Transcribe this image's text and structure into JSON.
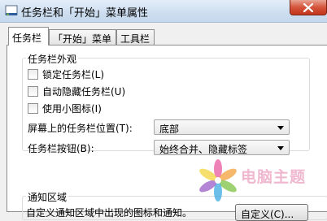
{
  "window": {
    "title": "任务栏和「开始」菜单属性",
    "close_icon": "close-icon"
  },
  "tabs": [
    {
      "label": "任务栏",
      "active": true
    },
    {
      "label": "「开始」菜单",
      "active": false
    },
    {
      "label": "工具栏",
      "active": false
    }
  ],
  "appearance": {
    "group_title": "任务栏外观",
    "checkboxes": [
      {
        "label": "锁定任务栏(L)",
        "checked": false
      },
      {
        "label": "自动隐藏任务栏(U)",
        "checked": false
      },
      {
        "label": "使用小图标(I)",
        "checked": false
      }
    ],
    "location_label": "屏幕上的任务栏位置(T):",
    "location_value": "底部",
    "buttons_label": "任务栏按钮(B):",
    "buttons_value": "始终合并、隐藏标签"
  },
  "notification": {
    "group_title": "通知区域",
    "description": "自定义通知区域中出现的图标和通知。",
    "customize_button": "自定义(C)..."
  },
  "watermark": {
    "text": "电脑主题",
    "colors": [
      "#e85aa0",
      "#f3a23b",
      "#7cc242",
      "#39a9e0",
      "#9a5cc6",
      "#f2d43c"
    ]
  }
}
